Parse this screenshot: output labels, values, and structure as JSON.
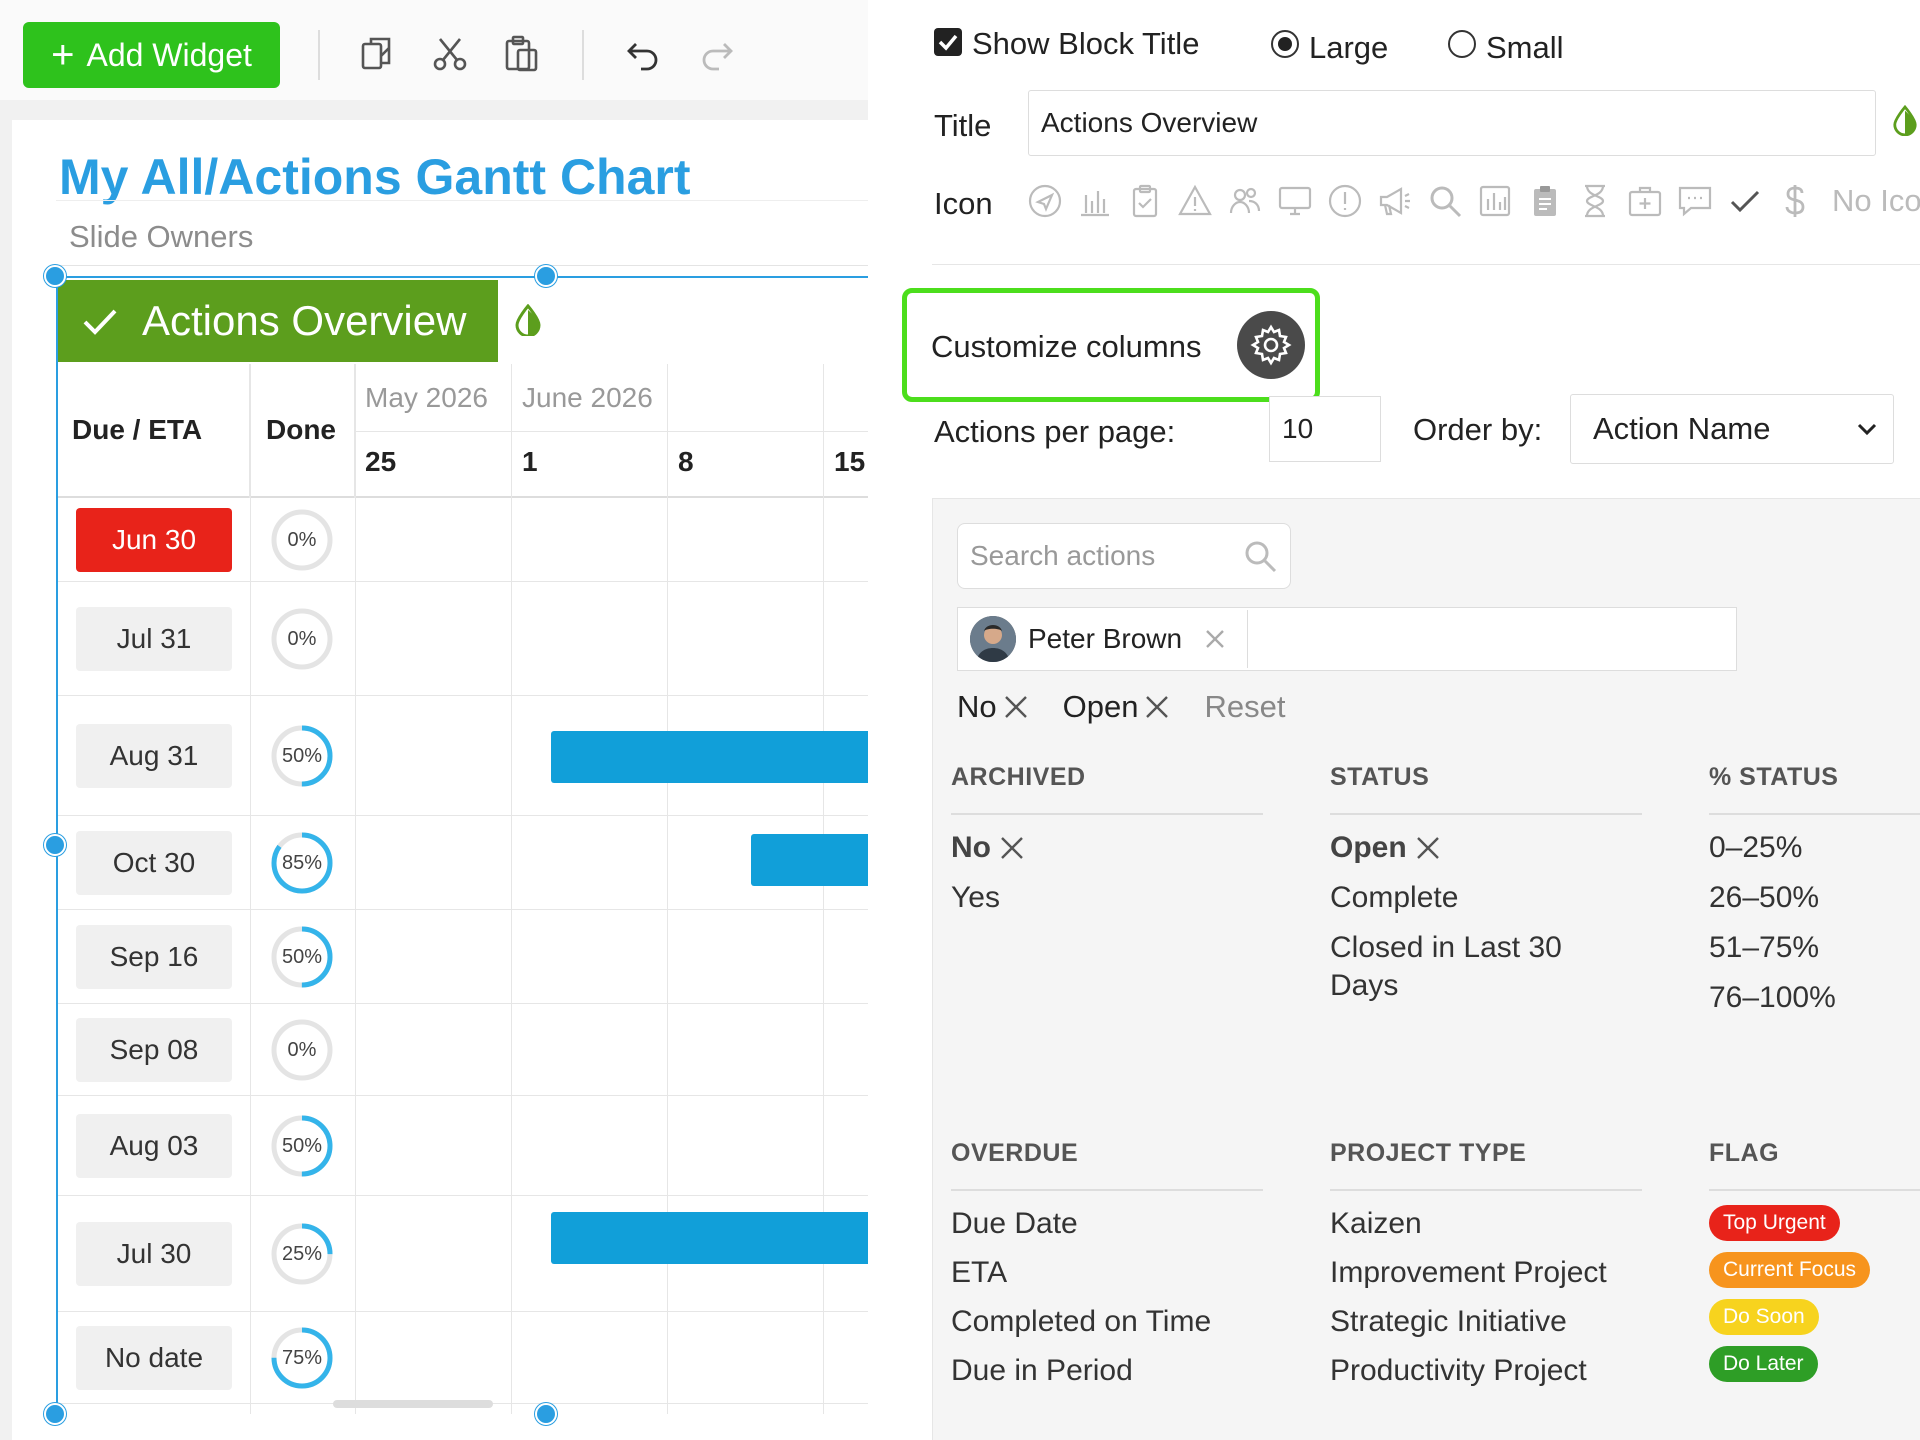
{
  "toolbar": {
    "add_widget_label": "Add Widget"
  },
  "slide": {
    "title": "My All/Actions Gantt Chart",
    "subtitle": "Slide Owners"
  },
  "block": {
    "header_title": "Actions Overview"
  },
  "gantt": {
    "col_due": "Due / ETA",
    "col_done": "Done",
    "months": [
      "May 2026",
      "June 2026"
    ],
    "weeks": [
      "25",
      "1",
      "8",
      "15"
    ],
    "rows": [
      {
        "due": "Jun 30",
        "done": "0%",
        "pct": 0,
        "overdue": true
      },
      {
        "due": "Jul 31",
        "done": "0%",
        "pct": 0,
        "overdue": false
      },
      {
        "due": "Aug 31",
        "done": "50%",
        "pct": 50,
        "overdue": false
      },
      {
        "due": "Oct 30",
        "done": "85%",
        "pct": 85,
        "overdue": false
      },
      {
        "due": "Sep 16",
        "done": "50%",
        "pct": 50,
        "overdue": false
      },
      {
        "due": "Sep 08",
        "done": "0%",
        "pct": 0,
        "overdue": false
      },
      {
        "due": "Aug 03",
        "done": "50%",
        "pct": 50,
        "overdue": false
      },
      {
        "due": "Jul 30",
        "done": "25%",
        "pct": 25,
        "overdue": false
      },
      {
        "due": "No date",
        "done": "75%",
        "pct": 75,
        "overdue": false
      }
    ]
  },
  "settings": {
    "show_block_title_label": "Show Block Title",
    "show_block_title_checked": true,
    "size_large": "Large",
    "size_small": "Small",
    "size_selected": "Large",
    "title_label": "Title",
    "title_value": "Actions Overview",
    "icon_label": "Icon",
    "icons": [
      "send-icon",
      "bar-chart-icon",
      "clipboard-check-icon",
      "warning-icon",
      "people-icon",
      "monitor-icon",
      "alert-circle-icon",
      "megaphone-icon",
      "search-icon",
      "chart-box-icon",
      "clipboard-icon",
      "hourglass-icon",
      "medkit-icon",
      "chat-icon",
      "check-icon",
      "dollar-icon"
    ],
    "no_icon_label": "No Icon",
    "customize_columns_label": "Customize columns",
    "actions_per_page_label": "Actions per page:",
    "actions_per_page_value": "10",
    "order_by_label": "Order by:",
    "order_by_value": "Action Name"
  },
  "filters": {
    "search_placeholder": "Search actions",
    "user_chip": "Peter Brown",
    "active_chips": [
      "No",
      "Open"
    ],
    "reset_label": "Reset",
    "archived": {
      "heading": "ARCHIVED",
      "items": [
        "No",
        "Yes"
      ],
      "selected": "No"
    },
    "status": {
      "heading": "STATUS",
      "items": [
        "Open",
        "Complete",
        "Closed in Last 30 Days"
      ],
      "selected": "Open"
    },
    "pct_status": {
      "heading": "% STATUS",
      "items": [
        "0–25%",
        "26–50%",
        "51–75%",
        "76–100%"
      ]
    },
    "overdue": {
      "heading": "OVERDUE",
      "items": [
        "Due Date",
        "ETA",
        "Completed on Time",
        "Due in Period"
      ]
    },
    "project_type": {
      "heading": "PROJECT TYPE",
      "items": [
        "Kaizen",
        "Improvement Project",
        "Strategic Initiative",
        "Productivity Project"
      ]
    },
    "flag": {
      "heading": "FLAG",
      "items": [
        {
          "label": "Top Urgent",
          "color": "#e8231a"
        },
        {
          "label": "Current Focus",
          "color": "#f7941d"
        },
        {
          "label": "Do Soon",
          "color": "#f7d31e"
        },
        {
          "label": "Do Later",
          "color": "#2e9e26"
        }
      ]
    }
  },
  "colors": {
    "accent_blue": "#2a9ee1",
    "add_green": "#2ec21c",
    "header_green": "#5c9e1d",
    "highlight_green": "#4cde1c",
    "bar_blue": "#119fd9",
    "overdue_red": "#e8231a"
  }
}
